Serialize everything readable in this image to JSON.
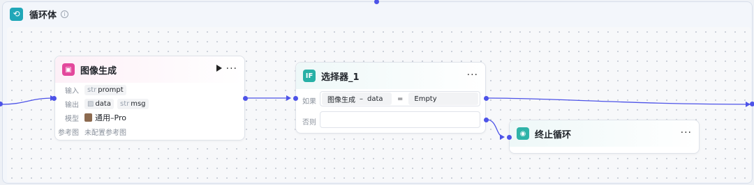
{
  "loop": {
    "title": "循环体",
    "info_icon": "info-icon"
  },
  "image_node": {
    "title": "图像生成",
    "input_label": "输入",
    "input_type": "str",
    "input_name": "prompt",
    "output_label": "输出",
    "output_1_name": "data",
    "output_2_type": "str",
    "output_2_name": "msg",
    "model_label": "模型",
    "model_value": "通用–Pro",
    "ref_label": "参考图",
    "ref_value": "未配置参考图",
    "more": "···"
  },
  "selector_node": {
    "title": "选择器_1",
    "icon_text": "IF",
    "if_label": "如果",
    "else_label": "否则",
    "cond_left_node": "图像生成",
    "cond_sep": "–",
    "cond_left_var": "data",
    "cond_op": "=",
    "cond_right": "Empty",
    "more": "···"
  },
  "stop_node": {
    "title": "终止循环",
    "more": "···"
  },
  "colors": {
    "accent": "#4d53e8",
    "loop_teal": "#20a7b8",
    "image_pink": "#e3489c",
    "stop_teal": "#2fb3a8"
  }
}
